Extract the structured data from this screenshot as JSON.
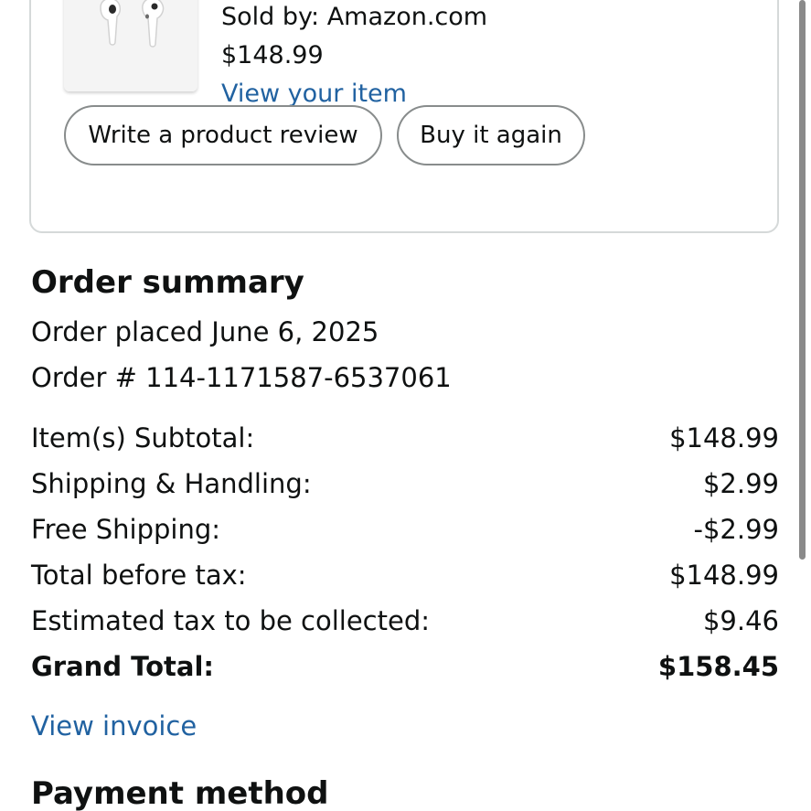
{
  "item": {
    "image_alt": "AirPods",
    "sold_by": "Sold by: Amazon.com",
    "price": "$148.99",
    "view_item": "View your item"
  },
  "actions": {
    "review_label": "Write a product review",
    "buy_again_label": "Buy it again"
  },
  "order_summary": {
    "title": "Order summary",
    "placed": "Order placed June 6, 2025",
    "order_number": "Order # 114-1171587-6537061",
    "rows": [
      {
        "label": "Item(s) Subtotal:",
        "amount": "$148.99"
      },
      {
        "label": "Shipping & Handling:",
        "amount": "$2.99"
      },
      {
        "label": "Free Shipping:",
        "amount": "-$2.99"
      },
      {
        "label": "Total before tax:",
        "amount": "$148.99"
      },
      {
        "label": "Estimated tax to be collected:",
        "amount": "$9.46"
      }
    ],
    "grand_total": {
      "label": "Grand Total:",
      "amount": "$158.45"
    },
    "view_invoice": "View invoice"
  },
  "payment": {
    "title": "Payment method"
  },
  "colors": {
    "link": "#2162a1",
    "text": "#0f1111",
    "border": "#d5d9d9"
  }
}
